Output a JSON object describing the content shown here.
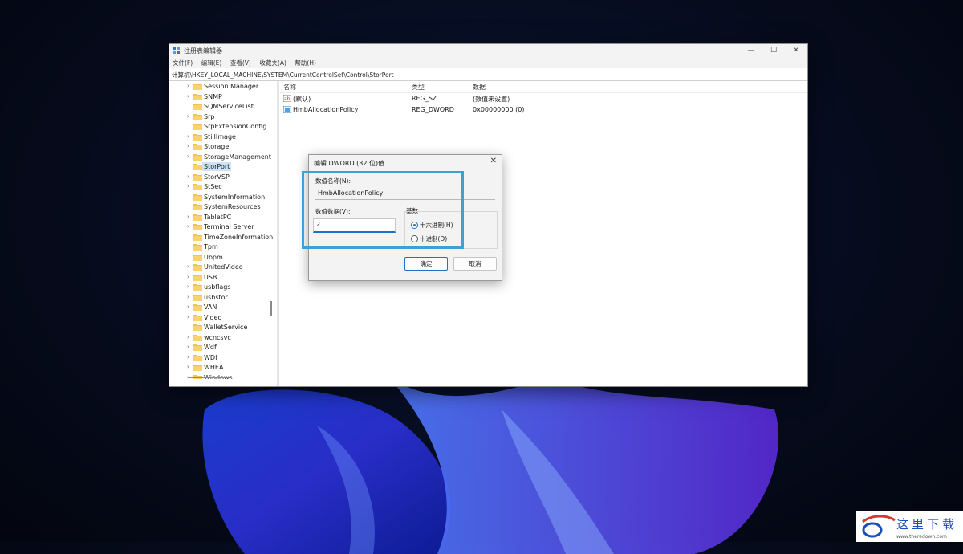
{
  "window": {
    "title": "注册表编辑器",
    "controls": {
      "minimize": "—",
      "maximize": "☐",
      "close": "✕"
    }
  },
  "menu": [
    "文件(F)",
    "编辑(E)",
    "查看(V)",
    "收藏夹(A)",
    "帮助(H)"
  ],
  "address": "计算机\\HKEY_LOCAL_MACHINE\\SYSTEM\\CurrentControlSet\\Control\\StorPort",
  "tree": {
    "items": [
      {
        "label": "Session Manager",
        "expandable": true
      },
      {
        "label": "SNMP",
        "expandable": true
      },
      {
        "label": "SQMServiceList",
        "expandable": false
      },
      {
        "label": "Srp",
        "expandable": true
      },
      {
        "label": "SrpExtensionConfig",
        "expandable": false
      },
      {
        "label": "StillImage",
        "expandable": true
      },
      {
        "label": "Storage",
        "expandable": true
      },
      {
        "label": "StorageManagement",
        "expandable": true
      },
      {
        "label": "StorPort",
        "expandable": false,
        "selected": true
      },
      {
        "label": "StorVSP",
        "expandable": true
      },
      {
        "label": "StSec",
        "expandable": true
      },
      {
        "label": "SystemInformation",
        "expandable": false
      },
      {
        "label": "SystemResources",
        "expandable": false
      },
      {
        "label": "TabletPC",
        "expandable": true
      },
      {
        "label": "Terminal Server",
        "expandable": true
      },
      {
        "label": "TimeZoneInformation",
        "expandable": false
      },
      {
        "label": "Tpm",
        "expandable": false
      },
      {
        "label": "Ubpm",
        "expandable": false
      },
      {
        "label": "UnitedVideo",
        "expandable": true
      },
      {
        "label": "USB",
        "expandable": true
      },
      {
        "label": "usbflags",
        "expandable": true
      },
      {
        "label": "usbstor",
        "expandable": true
      },
      {
        "label": "VAN",
        "expandable": true
      },
      {
        "label": "Video",
        "expandable": true
      },
      {
        "label": "WalletService",
        "expandable": false
      },
      {
        "label": "wcncsvc",
        "expandable": true
      },
      {
        "label": "Wdf",
        "expandable": true
      },
      {
        "label": "WDI",
        "expandable": true
      },
      {
        "label": "WHEA",
        "expandable": true
      },
      {
        "label": "Windows",
        "expandable": true
      }
    ]
  },
  "list": {
    "columns": {
      "name": "名称",
      "type": "类型",
      "data": "数据"
    },
    "rows": [
      {
        "icon": "string-value-icon",
        "name": "(默认)",
        "type": "REG_SZ",
        "data": "(数值未设置)"
      },
      {
        "icon": "dword-value-icon",
        "name": "HmbAllocationPolicy",
        "type": "REG_DWORD",
        "data": "0x00000000 (0)"
      }
    ]
  },
  "dialog": {
    "title": "编辑 DWORD (32 位)值",
    "name_label": "数值名称(N):",
    "name_value": "HmbAllocationPolicy",
    "data_label": "数值数据(V):",
    "data_value": "2",
    "base_label": "基数",
    "radio_hex": "十六进制(H)",
    "radio_dec": "十进制(D)",
    "selected_base": "hex",
    "ok_label": "确定",
    "cancel_label": "取消"
  },
  "colors": {
    "highlight": "#3da1d6",
    "accent": "#1f6fc2"
  },
  "watermark": {
    "text": "这里下载",
    "url": "www.theredown.com"
  }
}
